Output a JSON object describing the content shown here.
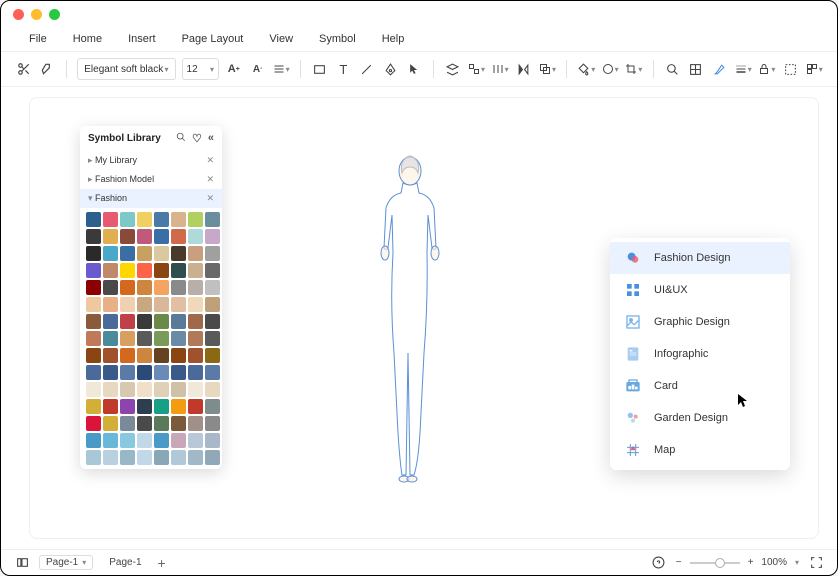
{
  "titlebar": {},
  "menubar": [
    "File",
    "Home",
    "Insert",
    "Page Layout",
    "View",
    "Symbol",
    "Help"
  ],
  "toolbar": {
    "font": "Elegant soft black",
    "size": "12"
  },
  "symbol_panel": {
    "title": "Symbol Library",
    "categories": [
      {
        "label": "My Library",
        "expanded": false,
        "active": false
      },
      {
        "label": "Fashion Model",
        "expanded": false,
        "active": false
      },
      {
        "label": "Fashion",
        "expanded": true,
        "active": true
      }
    ]
  },
  "context_menu": {
    "items": [
      {
        "label": "Fashion Design",
        "active": true,
        "icon_color": "#4a90e2"
      },
      {
        "label": "UI&UX",
        "active": false,
        "icon_color": "#4a90e2"
      },
      {
        "label": "Graphic Design",
        "active": false,
        "icon_color": "#7db3e8"
      },
      {
        "label": "Infographic",
        "active": false,
        "icon_color": "#a8cdf0"
      },
      {
        "label": "Card",
        "active": false,
        "icon_color": "#6ba8e0"
      },
      {
        "label": "Garden Design",
        "active": false,
        "icon_color": "#8fc5ed"
      },
      {
        "label": "Map",
        "active": false,
        "icon_color": "#5b9bd5"
      }
    ]
  },
  "statusbar": {
    "page_select": "Page-1",
    "page_tab": "Page-1",
    "zoom": "100%"
  },
  "swatch_colors": [
    "#2c5f8d",
    "#e85a71",
    "#7ec8c8",
    "#f0d060",
    "#4a7ba6",
    "#d9b38c",
    "#b0d060",
    "#6b8e9e",
    "#3a3a3a",
    "#e0b050",
    "#8a4a3a",
    "#c05a7a",
    "#3a6ea5",
    "#d06a4a",
    "#b0d9d9",
    "#c8a8c8",
    "#2a2a2a",
    "#4aa8c8",
    "#3a6ea5",
    "#c8a060",
    "#d9c8a0",
    "#4a3a2a",
    "#c8a080",
    "#a0a0a0",
    "#6a5acd",
    "#c08a6a",
    "#ffd700",
    "#ff6347",
    "#8b4513",
    "#2f4f4f",
    "#c8b090",
    "#696969",
    "#8b0000",
    "#4a4a4a",
    "#d2691e",
    "#cd853f",
    "#f4a460",
    "#8a8a8a",
    "#b8b0a8",
    "#c0c0c0",
    "#f0c8a0",
    "#e8b088",
    "#f0d0b0",
    "#c8a880",
    "#d8b898",
    "#e0c0a0",
    "#f0d8b8",
    "#c0a078",
    "#8a5a3a",
    "#4a6a9a",
    "#c0404a",
    "#3a3a3a",
    "#6a8a4a",
    "#5a7a9a",
    "#a06a4a",
    "#4a4a4a",
    "#c07a5a",
    "#4a8a9a",
    "#d8a060",
    "#5a5a5a",
    "#7a9a5a",
    "#6a8aa8",
    "#b07a5a",
    "#5a5a5a",
    "#8b4513",
    "#a0522d",
    "#d2691e",
    "#cd853f",
    "#654321",
    "#8b4513",
    "#a0522d",
    "#8b6914",
    "#4a6a9a",
    "#3a5a8a",
    "#5a7aa8",
    "#2a4a7a",
    "#6a8ab8",
    "#3a5a8a",
    "#4a6a9a",
    "#5a7aa8",
    "#f0e8d8",
    "#e8d8c0",
    "#d8c8b0",
    "#f0e0c8",
    "#e0d0b8",
    "#d0c0a8",
    "#f0e8d8",
    "#e8d8c0",
    "#d4af37",
    "#c0392b",
    "#8e44ad",
    "#2c3e50",
    "#16a085",
    "#f39c12",
    "#c0392b",
    "#7f8c8d",
    "#dc143c",
    "#d4af37",
    "#7a8a9a",
    "#4a4a4a",
    "#5a7a5a",
    "#7a5a3a",
    "#a09088",
    "#8a8a8a",
    "#4a9ac8",
    "#6ab8d8",
    "#8ac8e0",
    "#c0d8e8",
    "#4a9ac8",
    "#c8a8b8",
    "#b8c8d8",
    "#a8b8c8",
    "#a8c8d8",
    "#b8d0e0",
    "#98b8c8",
    "#c0d8e8",
    "#88a8b8",
    "#b0c8d8",
    "#a0b8c8",
    "#90a8b8"
  ]
}
